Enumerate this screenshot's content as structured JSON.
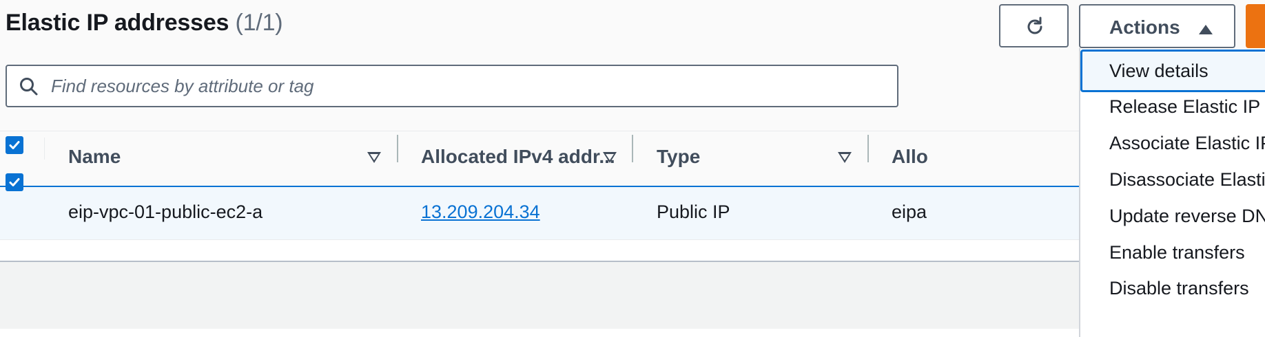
{
  "header": {
    "title": "Elastic IP addresses",
    "count": "(1/1)"
  },
  "toolbar": {
    "refresh_icon": "refresh-icon",
    "actions_label": "Actions"
  },
  "search": {
    "placeholder": "Find resources by attribute or tag",
    "value": ""
  },
  "table": {
    "columns": [
      {
        "label": "Name"
      },
      {
        "label": "Allocated IPv4 addr..."
      },
      {
        "label": "Type"
      },
      {
        "label": "Allo"
      }
    ],
    "rows": [
      {
        "selected": true,
        "name": "eip-vpc-01-public-ec2-a",
        "ip": "13.209.204.34",
        "type": "Public IP",
        "allocation": "eipa"
      }
    ]
  },
  "actions_menu": {
    "items": [
      "View details",
      "Release Elastic IP a",
      "Associate Elastic IP",
      "Disassociate Elasti",
      "Update reverse DN",
      "Enable transfers",
      "Disable transfers"
    ]
  },
  "colors": {
    "accent": "#0972d3",
    "primary_button": "#ec7211"
  }
}
